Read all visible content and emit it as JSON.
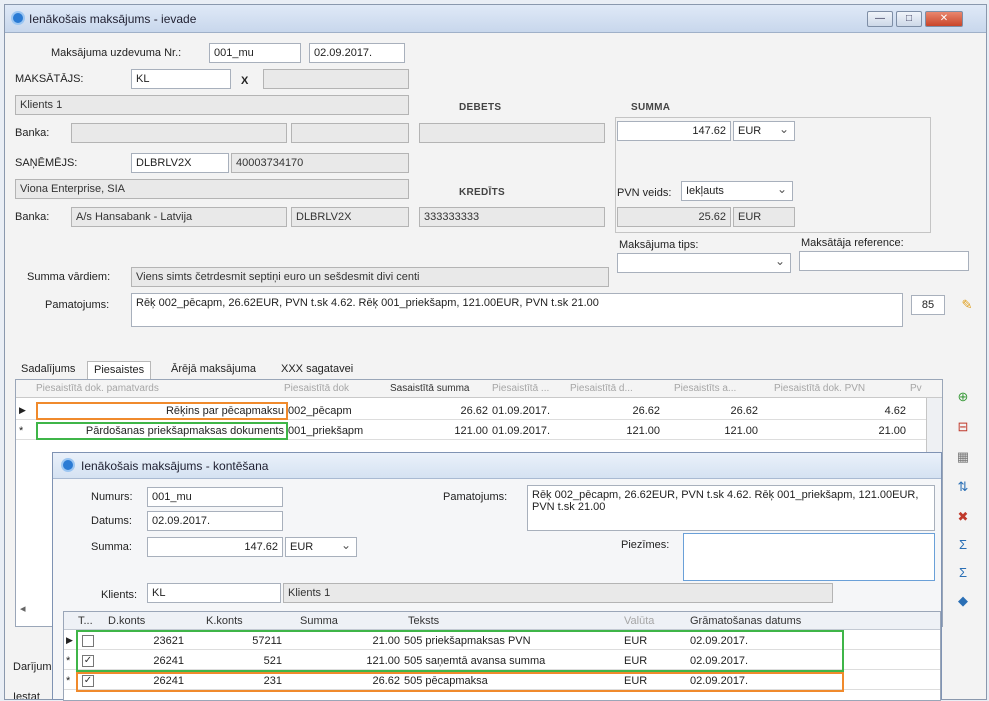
{
  "win1": {
    "title": "Ienākošais maksājums - ievade",
    "btn_min": "—",
    "btn_max": "□",
    "btn_close": "✕"
  },
  "form": {
    "nr_label": "Maksājuma uzdevuma Nr.:",
    "nr_value": "001_mu",
    "date_value": "02.09.2017.",
    "payer_label": "MAKSĀTĀJS:",
    "payer_code": "KL",
    "x_label": "X",
    "client_name": "Klients 1",
    "bank_label": "Banka:",
    "debets_label": "DEBETS",
    "summa_label": "SUMMA",
    "summa_value": "147.62",
    "currency": "EUR",
    "receiver_label": "SAŅĒMĒJS:",
    "receiver_bic": "DLBRLV2X",
    "receiver_reg": "40003734170",
    "receiver_name": "Viona Enterprise, SIA",
    "kredits_label": "KREDĪTS",
    "pvn_label": "PVN veids:",
    "pvn_value": "Iekļauts",
    "pvn_amount": "25.62",
    "pvn_currency": "EUR",
    "bank2_label": "Banka:",
    "bank2_name": "A/s Hansabank - Latvija",
    "bank2_bic": "DLBRLV2X",
    "bank2_account": "333333333",
    "type_label": "Maksājuma tips:",
    "ref_label": "Maksātāja reference:",
    "words_label": "Summa vārdiem:",
    "words_value": "Viens simts četrdesmit septiņi euro un sešdesmit divi centi",
    "purpose_label": "Pamatojums:",
    "purpose_value": "Rēķ 002_pēcapm, 26.62EUR, PVN t.sk 4.62. Rēķ 001_priekšapm, 121.00EUR, PVN t.sk 21.00",
    "purpose_code": "85"
  },
  "tabs": [
    "Sadalījums",
    "Piesaistes",
    "Ārējā maksājuma",
    "XXX sagatavei"
  ],
  "grid1": {
    "headers": [
      "Piesaistītā dok. pamatvards",
      "Piesaistītā dok",
      "Sasaistītā summa",
      "Piesaistītā ...",
      "Piesaistītā d...",
      "Piesaistīts a...",
      "Piesaistītā dok. PVN",
      "Pv"
    ],
    "rows": [
      {
        "name": "Rēķins par pēcapmaksu",
        "doc": "002_pēcapm",
        "amount": "26.62",
        "date": "01.09.2017.",
        "v1": "26.62",
        "v2": "26.62",
        "vat": "4.62"
      },
      {
        "name": "Pārdošanas priekšapmaksas dokuments",
        "doc": "001_priekšapm",
        "amount": "121.00",
        "date": "01.09.2017.",
        "v1": "121.00",
        "v2": "121.00",
        "vat": "21.00"
      }
    ]
  },
  "win2": {
    "title": "Ienākošais maksājums - kontēšana",
    "numurs_label": "Numurs:",
    "numurs_value": "001_mu",
    "datums_label": "Datums:",
    "datums_value": "02.09.2017.",
    "summa_label": "Summa:",
    "summa_value": "147.62",
    "currency": "EUR",
    "pamatojums_label": "Pamatojums:",
    "pamatojums_value": "Rēķ 002_pēcapm, 26.62EUR, PVN t.sk 4.62. Rēķ 001_priekšapm, 121.00EUR, PVN t.sk 21.00",
    "piezimes_label": "Piezīmes:",
    "klients_label": "Klients:",
    "klients_code": "KL",
    "klients_name": "Klients 1",
    "grid_headers": [
      "T...",
      "D.konts",
      "K.konts",
      "Summa",
      "Teksts",
      "Valūta",
      "Grāmatošanas datums"
    ],
    "rows": [
      {
        "dk": "23621",
        "kk": "57211",
        "sum": "21.00",
        "text": "505 priekšapmaksas PVN",
        "cur": "EUR",
        "date": "02.09.2017.",
        "checked": ""
      },
      {
        "dk": "26241",
        "kk": "521",
        "sum": "121.00",
        "text": "505 saņemtā avansa summa",
        "cur": "EUR",
        "date": "02.09.2017.",
        "checked": "✓"
      },
      {
        "dk": "26241",
        "kk": "231",
        "sum": "26.62",
        "text": "505 pēcapmaksa",
        "cur": "EUR",
        "date": "02.09.2017.",
        "checked": "✓"
      }
    ]
  },
  "bottom": {
    "label1": "Darījum",
    "label2": "Iestat"
  },
  "colors": {
    "orange": "#f08a2c",
    "green": "#3fb548"
  }
}
